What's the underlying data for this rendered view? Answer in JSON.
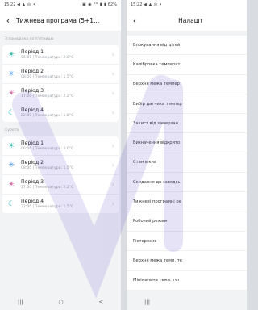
{
  "left": {
    "status": {
      "time": "15:22",
      "left_icons": "◀ ▲ ◎ •",
      "right_icons": "▣ ◉ ⁴ᴳ ▮ ▮",
      "battery": "62%"
    },
    "title": "Тижнева програма (5+1...",
    "weekdays": {
      "title": "З понеділка по п'ятницю",
      "periods": [
        {
          "name": "Період 1",
          "info": "06:00 | Температура: 2.0°C",
          "icon": "sunrise-icon",
          "color": "#2ab3a6"
        },
        {
          "name": "Період 2",
          "info": "08:00 | Температура: 1.5°C",
          "icon": "sun-icon",
          "color": "#3b8ff0"
        },
        {
          "name": "Період 3",
          "info": "17:00 | Температура: 2.2°C",
          "icon": "sunset-icon",
          "color": "#e05fa0"
        },
        {
          "name": "Період 4",
          "info": "22:00 | Температура: 1.8°C",
          "icon": "moon-icon",
          "color": "#19b0b8"
        }
      ]
    },
    "saturday": {
      "title": "Субота",
      "periods": [
        {
          "name": "Період 1",
          "info": "06:00 | Температура: 2.0°C",
          "icon": "sunrise-icon",
          "color": "#2ab3a6"
        },
        {
          "name": "Період 2",
          "info": "08:00 | Температура: 1.5°C",
          "icon": "sun-icon",
          "color": "#3b8ff0"
        },
        {
          "name": "Період 3",
          "info": "17:00 | Температура: 2.2°C",
          "icon": "sunset-icon",
          "color": "#e05fa0"
        },
        {
          "name": "Період 4",
          "info": "22:00 | Температура: 1.5°C",
          "icon": "moon-icon",
          "color": "#19b0b8"
        }
      ]
    },
    "nav": {
      "menu": "|||",
      "home": "○",
      "back": "<"
    }
  },
  "right": {
    "status": {
      "time": "15:22",
      "left_icons": "◀ ▲ ◎ •"
    },
    "title": "Налашт",
    "items": [
      "Блокування від дітей",
      "Калібровка температ",
      "Верхня межа темпер",
      "Вибір датчика темпер",
      "Захист від замерзан",
      "Визначення відкрито",
      "Стан вікна",
      "Скидання до заводсь",
      "Тижневі програмні ре",
      "Робочий режим",
      "Гістерезис",
      "Верхня межа темп. те",
      "Мінімальна темп. тег"
    ],
    "nav": {
      "menu": "|||"
    }
  },
  "colors": {
    "watermark": "#6a5acd",
    "background": "#f2f3f5"
  }
}
